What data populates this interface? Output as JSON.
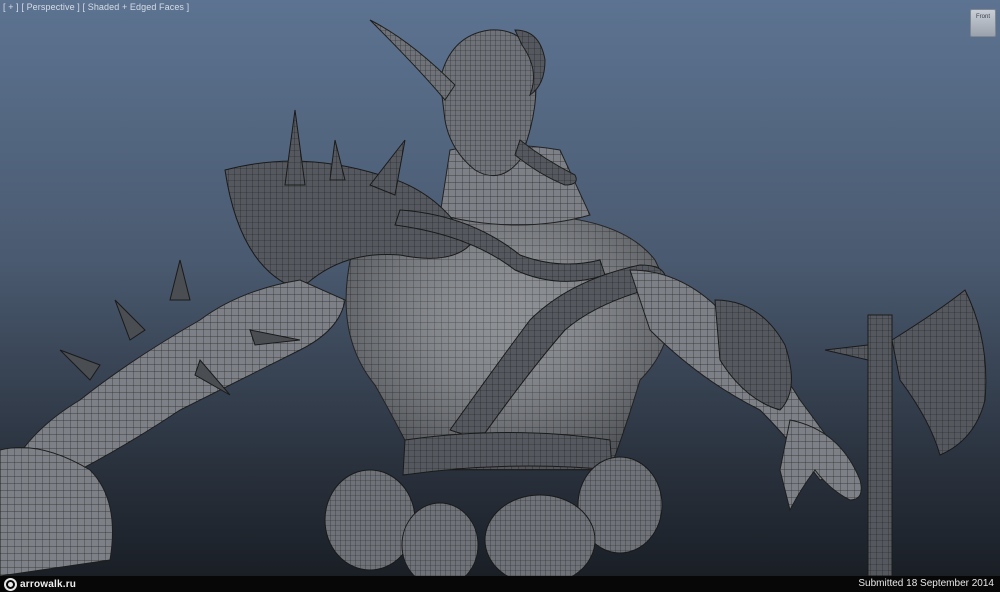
{
  "viewport": {
    "label_plus": "[ + ]",
    "label_view": "[ Perspective ]",
    "label_shading": "[ Shaded + Edged Faces ]",
    "viewcube_text": "Front"
  },
  "footer": {
    "logo_text": "arrowalk.ru",
    "submitted": "Submitted 18 September 2014"
  },
  "colors": {
    "background_top": "#5c7391",
    "background_bottom": "#1a1f26",
    "mesh_fill": "#7a7e84",
    "wire": "#262626",
    "footer_bg": "#070707"
  }
}
